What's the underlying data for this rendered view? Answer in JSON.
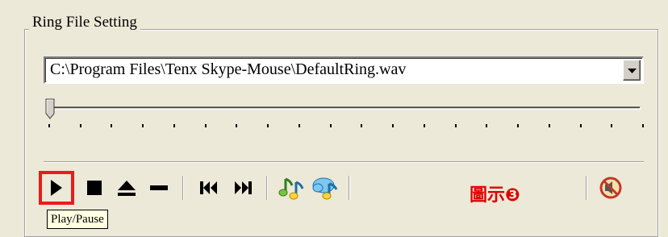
{
  "group": {
    "title": "Ring File Setting"
  },
  "ring_file": {
    "value": "C:\\Program Files\\Tenx Skype-Mouse\\DefaultRing.wav"
  },
  "slider": {
    "value_fraction": 0.0,
    "tick_count": 20
  },
  "toolbar": {
    "buttons": [
      {
        "name": "play-pause-button",
        "icon": "play-icon"
      },
      {
        "name": "stop-button",
        "icon": "stop-icon"
      },
      {
        "name": "eject-button",
        "icon": "eject-icon"
      },
      {
        "name": "minus-button",
        "icon": "minus-icon"
      },
      {
        "name": "previous-track-button",
        "icon": "skip-back-icon"
      },
      {
        "name": "next-track-button",
        "icon": "skip-forward-icon"
      },
      {
        "name": "music-notes-button",
        "icon": "music-notes-icon"
      },
      {
        "name": "music-note-cloud-button",
        "icon": "music-cloud-icon"
      },
      {
        "name": "mute-button",
        "icon": "no-sound-icon"
      }
    ],
    "highlight_color": "#e81c1c"
  },
  "annotation": {
    "label": "圖示❸",
    "color": "#e00000"
  },
  "tooltip": {
    "text": "Play/Pause"
  }
}
